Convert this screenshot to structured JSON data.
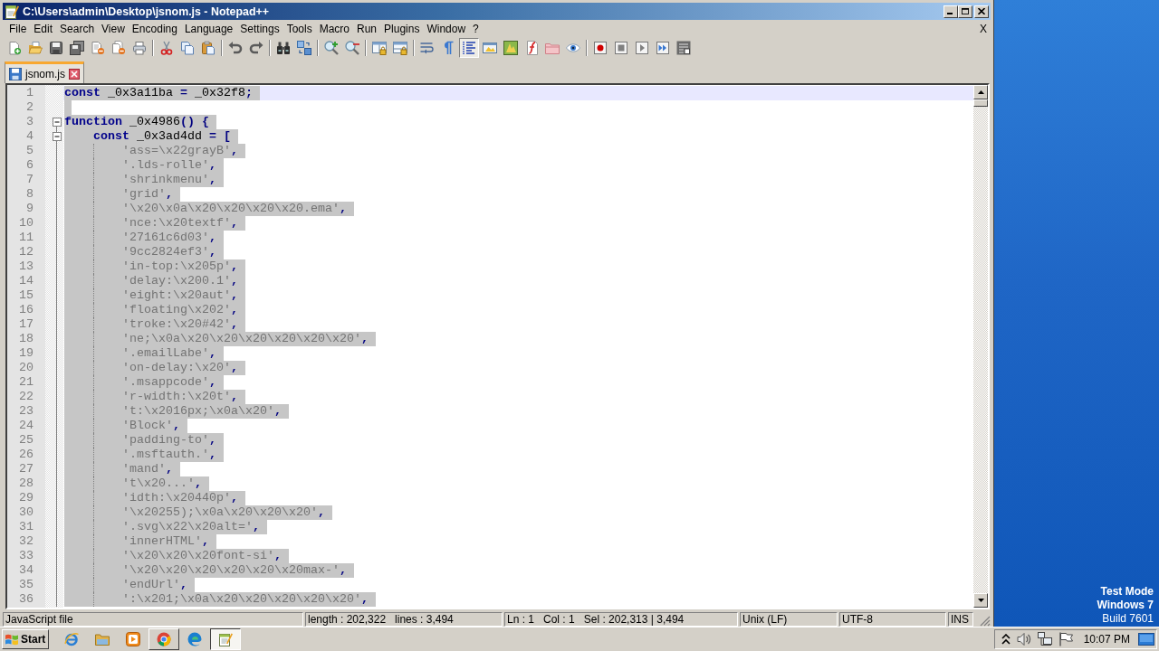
{
  "window": {
    "title": "C:\\Users\\admin\\Desktop\\jsnom.js - Notepad++"
  },
  "menu": {
    "items": [
      "File",
      "Edit",
      "Search",
      "View",
      "Encoding",
      "Language",
      "Settings",
      "Tools",
      "Macro",
      "Run",
      "Plugins",
      "Window",
      "?"
    ],
    "close": "X"
  },
  "toolbar": {
    "groups": [
      {
        "buttons": [
          {
            "pressed": false
          },
          {
            "pressed": false
          },
          {
            "pressed": false
          },
          {
            "pressed": false
          },
          {
            "pressed": false
          },
          {
            "pressed": false
          },
          {
            "pressed": false
          }
        ]
      },
      {
        "buttons": [
          {
            "pressed": false
          },
          {
            "pressed": false
          },
          {
            "pressed": false
          }
        ]
      },
      {
        "buttons": [
          {
            "pressed": false
          },
          {
            "pressed": false
          }
        ]
      },
      {
        "buttons": [
          {
            "pressed": false
          },
          {
            "pressed": false
          }
        ]
      },
      {
        "buttons": [
          {
            "pressed": false
          },
          {
            "pressed": false
          }
        ]
      },
      {
        "buttons": [
          {
            "pressed": false
          },
          {
            "pressed": false
          }
        ]
      },
      {
        "buttons": [
          {
            "pressed": false
          },
          {
            "pressed": false
          },
          {
            "pressed": true
          },
          {
            "pressed": false
          },
          {
            "pressed": false
          },
          {
            "pressed": false
          },
          {
            "pressed": false
          },
          {
            "pressed": false
          }
        ]
      },
      {
        "buttons": [
          {
            "pressed": false
          },
          {
            "pressed": false
          },
          {
            "pressed": false
          },
          {
            "pressed": false
          },
          {
            "pressed": false
          }
        ]
      }
    ]
  },
  "tabs": [
    {
      "label": "jsnom.js",
      "selected": true
    }
  ],
  "editor": {
    "lines": [
      {
        "number": "1",
        "selected": true,
        "current": true,
        "tokens": [
          {
            "kind": "keyword",
            "text": "const"
          },
          {
            "kind": "identifier",
            "text": " _0x3a11ba "
          },
          {
            "kind": "operator",
            "text": "="
          },
          {
            "kind": "identifier",
            "text": " _0x32f8"
          },
          {
            "kind": "operator",
            "text": ";"
          }
        ]
      },
      {
        "number": "2",
        "selected": true,
        "current": false
      },
      {
        "number": "3",
        "selected": true,
        "current": false,
        "expanded": true,
        "tokens": [
          {
            "kind": "keyword",
            "text": "function"
          },
          {
            "kind": "identifier",
            "text": " _0x4986"
          },
          {
            "kind": "operator",
            "text": "() {"
          }
        ],
        "children": [
          {
            "number": "4",
            "selected": true,
            "current": false,
            "expanded": true,
            "tokens": [
              {
                "kind": "keyword",
                "text": "const"
              },
              {
                "kind": "identifier",
                "text": " _0x3ad4dd "
              },
              {
                "kind": "operator",
                "text": "= ["
              }
            ],
            "children": [
              {
                "number": "5",
                "selected": true,
                "current": false,
                "tokens": [
                  {
                    "kind": "string",
                    "text": "'ass=\\x22grayB'"
                  },
                  {
                    "kind": "operator",
                    "text": ","
                  }
                ]
              },
              {
                "number": "6",
                "selected": true,
                "current": false,
                "tokens": [
                  {
                    "kind": "string",
                    "text": "'.lds-rolle'"
                  },
                  {
                    "kind": "operator",
                    "text": ","
                  }
                ]
              },
              {
                "number": "7",
                "selected": true,
                "current": false,
                "tokens": [
                  {
                    "kind": "string",
                    "text": "'shrinkmenu'"
                  },
                  {
                    "kind": "operator",
                    "text": ","
                  }
                ]
              },
              {
                "number": "8",
                "selected": true,
                "current": false,
                "tokens": [
                  {
                    "kind": "string",
                    "text": "'grid'"
                  },
                  {
                    "kind": "operator",
                    "text": ","
                  }
                ]
              },
              {
                "number": "9",
                "selected": true,
                "current": false,
                "tokens": [
                  {
                    "kind": "string",
                    "text": "'\\x20\\x0a\\x20\\x20\\x20\\x20.ema'"
                  },
                  {
                    "kind": "operator",
                    "text": ","
                  }
                ]
              },
              {
                "number": "10",
                "selected": true,
                "current": false,
                "tokens": [
                  {
                    "kind": "string",
                    "text": "'nce:\\x20textf'"
                  },
                  {
                    "kind": "operator",
                    "text": ","
                  }
                ]
              },
              {
                "number": "11",
                "selected": true,
                "current": false,
                "tokens": [
                  {
                    "kind": "string",
                    "text": "'27161c6d03'"
                  },
                  {
                    "kind": "operator",
                    "text": ","
                  }
                ]
              },
              {
                "number": "12",
                "selected": true,
                "current": false,
                "tokens": [
                  {
                    "kind": "string",
                    "text": "'9cc2824ef3'"
                  },
                  {
                    "kind": "operator",
                    "text": ","
                  }
                ]
              },
              {
                "number": "13",
                "selected": true,
                "current": false,
                "tokens": [
                  {
                    "kind": "string",
                    "text": "'in-top:\\x205p'"
                  },
                  {
                    "kind": "operator",
                    "text": ","
                  }
                ]
              },
              {
                "number": "14",
                "selected": true,
                "current": false,
                "tokens": [
                  {
                    "kind": "string",
                    "text": "'delay:\\x200.1'"
                  },
                  {
                    "kind": "operator",
                    "text": ","
                  }
                ]
              },
              {
                "number": "15",
                "selected": true,
                "current": false,
                "tokens": [
                  {
                    "kind": "string",
                    "text": "'eight:\\x20aut'"
                  },
                  {
                    "kind": "operator",
                    "text": ","
                  }
                ]
              },
              {
                "number": "16",
                "selected": true,
                "current": false,
                "tokens": [
                  {
                    "kind": "string",
                    "text": "'floating\\x202'"
                  },
                  {
                    "kind": "operator",
                    "text": ","
                  }
                ]
              },
              {
                "number": "17",
                "selected": true,
                "current": false,
                "tokens": [
                  {
                    "kind": "string",
                    "text": "'troke:\\x20#42'"
                  },
                  {
                    "kind": "operator",
                    "text": ","
                  }
                ]
              },
              {
                "number": "18",
                "selected": true,
                "current": false,
                "tokens": [
                  {
                    "kind": "string",
                    "text": "'ne;\\x0a\\x20\\x20\\x20\\x20\\x20\\x20'"
                  },
                  {
                    "kind": "operator",
                    "text": ","
                  }
                ]
              },
              {
                "number": "19",
                "selected": true,
                "current": false,
                "tokens": [
                  {
                    "kind": "string",
                    "text": "'.emailLabe'"
                  },
                  {
                    "kind": "operator",
                    "text": ","
                  }
                ]
              },
              {
                "number": "20",
                "selected": true,
                "current": false,
                "tokens": [
                  {
                    "kind": "string",
                    "text": "'on-delay:\\x20'"
                  },
                  {
                    "kind": "operator",
                    "text": ","
                  }
                ]
              },
              {
                "number": "21",
                "selected": true,
                "current": false,
                "tokens": [
                  {
                    "kind": "string",
                    "text": "'.msappcode'"
                  },
                  {
                    "kind": "operator",
                    "text": ","
                  }
                ]
              },
              {
                "number": "22",
                "selected": true,
                "current": false,
                "tokens": [
                  {
                    "kind": "string",
                    "text": "'r-width:\\x20t'"
                  },
                  {
                    "kind": "operator",
                    "text": ","
                  }
                ]
              },
              {
                "number": "23",
                "selected": true,
                "current": false,
                "tokens": [
                  {
                    "kind": "string",
                    "text": "'t:\\x2016px;\\x0a\\x20'"
                  },
                  {
                    "kind": "operator",
                    "text": ","
                  }
                ]
              },
              {
                "number": "24",
                "selected": true,
                "current": false,
                "tokens": [
                  {
                    "kind": "string",
                    "text": "'Block'"
                  },
                  {
                    "kind": "operator",
                    "text": ","
                  }
                ]
              },
              {
                "number": "25",
                "selected": true,
                "current": false,
                "tokens": [
                  {
                    "kind": "string",
                    "text": "'padding-to'"
                  },
                  {
                    "kind": "operator",
                    "text": ","
                  }
                ]
              },
              {
                "number": "26",
                "selected": true,
                "current": false,
                "tokens": [
                  {
                    "kind": "string",
                    "text": "'.msftauth.'"
                  },
                  {
                    "kind": "operator",
                    "text": ","
                  }
                ]
              },
              {
                "number": "27",
                "selected": true,
                "current": false,
                "tokens": [
                  {
                    "kind": "string",
                    "text": "'mand'"
                  },
                  {
                    "kind": "operator",
                    "text": ","
                  }
                ]
              },
              {
                "number": "28",
                "selected": true,
                "current": false,
                "tokens": [
                  {
                    "kind": "string",
                    "text": "'t\\x20...'"
                  },
                  {
                    "kind": "operator",
                    "text": ","
                  }
                ]
              },
              {
                "number": "29",
                "selected": true,
                "current": false,
                "tokens": [
                  {
                    "kind": "string",
                    "text": "'idth:\\x20440p'"
                  },
                  {
                    "kind": "operator",
                    "text": ","
                  }
                ]
              },
              {
                "number": "30",
                "selected": true,
                "current": false,
                "tokens": [
                  {
                    "kind": "string",
                    "text": "'\\x20255);\\x0a\\x20\\x20\\x20'"
                  },
                  {
                    "kind": "operator",
                    "text": ","
                  }
                ]
              },
              {
                "number": "31",
                "selected": true,
                "current": false,
                "tokens": [
                  {
                    "kind": "string",
                    "text": "'.svg\\x22\\x20alt='"
                  },
                  {
                    "kind": "operator",
                    "text": ","
                  }
                ]
              },
              {
                "number": "32",
                "selected": true,
                "current": false,
                "tokens": [
                  {
                    "kind": "string",
                    "text": "'innerHTML'"
                  },
                  {
                    "kind": "operator",
                    "text": ","
                  }
                ]
              },
              {
                "number": "33",
                "selected": true,
                "current": false,
                "tokens": [
                  {
                    "kind": "string",
                    "text": "'\\x20\\x20\\x20font-si'"
                  },
                  {
                    "kind": "operator",
                    "text": ","
                  }
                ]
              },
              {
                "number": "34",
                "selected": true,
                "current": false,
                "tokens": [
                  {
                    "kind": "string",
                    "text": "'\\x20\\x20\\x20\\x20\\x20\\x20max-'"
                  },
                  {
                    "kind": "operator",
                    "text": ","
                  }
                ]
              },
              {
                "number": "35",
                "selected": true,
                "current": false,
                "tokens": [
                  {
                    "kind": "string",
                    "text": "'endUrl'"
                  },
                  {
                    "kind": "operator",
                    "text": ","
                  }
                ]
              },
              {
                "number": "36",
                "selected": true,
                "current": false,
                "tokens": [
                  {
                    "kind": "string",
                    "text": "':\\x201;\\x0a\\x20\\x20\\x20\\x20\\x20'"
                  },
                  {
                    "kind": "operator",
                    "text": ","
                  }
                ]
              }
            ]
          }
        ]
      }
    ]
  },
  "status_bar": {
    "file_type": "JavaScript file",
    "length": "length : 202,322",
    "lines": "lines : 3,494",
    "line": "Ln : 1",
    "column": "Col : 1",
    "selection": "Sel : 202,313 | 3,494",
    "line_endings": "Unix (LF)",
    "encoding": "UTF-8",
    "mode": "INS"
  },
  "taskbar": {
    "start": "Start",
    "apps": [
      {
        "running": false,
        "selected": false
      },
      {
        "running": false,
        "selected": false
      },
      {
        "running": false,
        "selected": false
      },
      {
        "running": true,
        "selected": false
      },
      {
        "running": false,
        "selected": false
      },
      {
        "running": true,
        "selected": true
      }
    ],
    "clock": "10:07 PM"
  },
  "desktop": {
    "notices": [
      "Test Mode",
      "Windows 7",
      "Build 7601"
    ]
  }
}
